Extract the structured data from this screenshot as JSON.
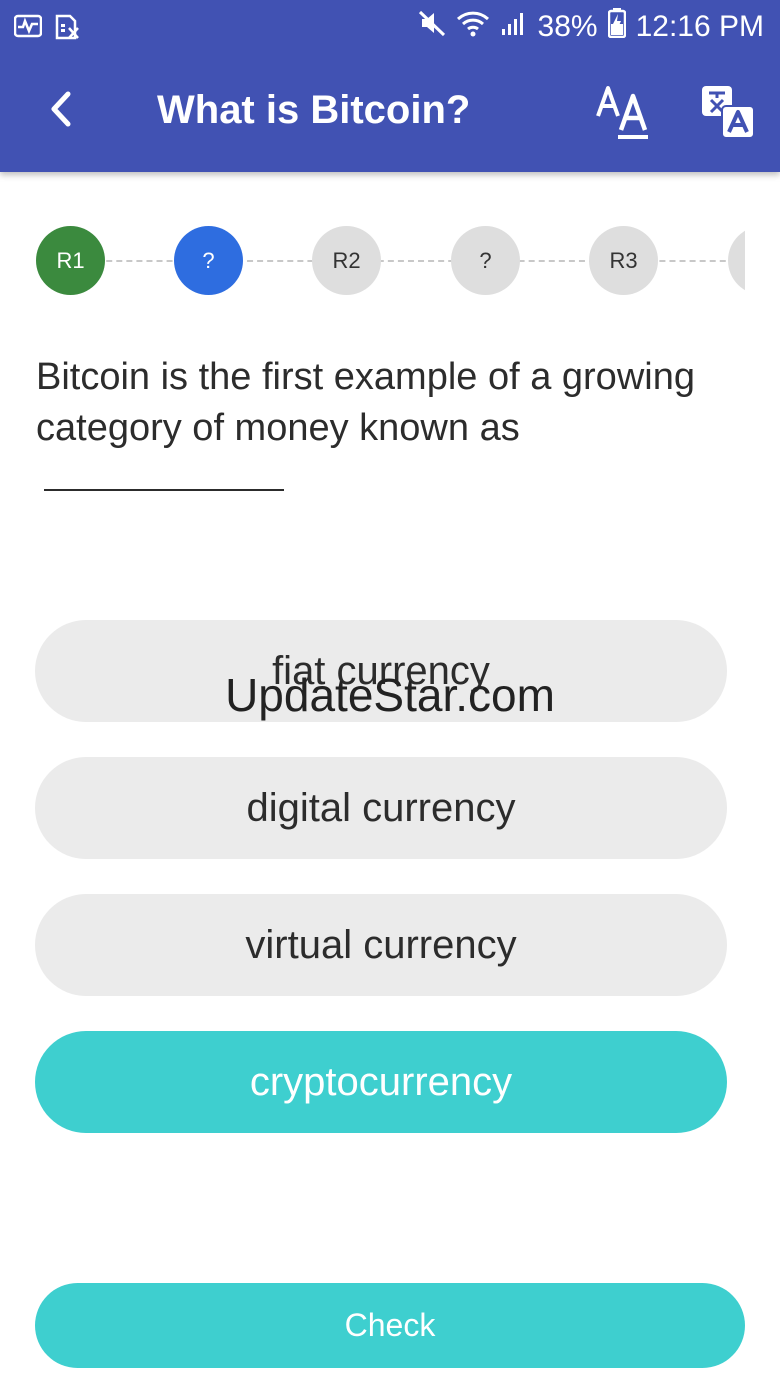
{
  "status_bar": {
    "battery": "38%",
    "time": "12:16 PM",
    "icons": [
      "activity-icon",
      "sim-off-icon",
      "mute-icon",
      "wifi-icon",
      "signal-icon",
      "battery-charging-icon"
    ]
  },
  "header": {
    "title": "What is Bitcoin?",
    "back_icon": "back-chevron-icon",
    "font_size_icon": "font-size-icon",
    "translate_icon": "translate-icon",
    "color": "#4152b3"
  },
  "progress": {
    "steps": [
      {
        "label": "R1",
        "state": "done"
      },
      {
        "label": "?",
        "state": "current"
      },
      {
        "label": "R2",
        "state": "pending"
      },
      {
        "label": "?",
        "state": "pending"
      },
      {
        "label": "R3",
        "state": "pending"
      },
      {
        "label": "",
        "state": "pending"
      }
    ]
  },
  "question": {
    "text": "Bitcoin is the first example of a growing category of money known as"
  },
  "options": [
    {
      "label": "fiat currency",
      "selected": false
    },
    {
      "label": "digital currency",
      "selected": false
    },
    {
      "label": "virtual currency",
      "selected": false
    },
    {
      "label": "cryptocurrency",
      "selected": true
    }
  ],
  "watermark": "UpdateStar.com",
  "check_button": {
    "label": "Check"
  },
  "colors": {
    "accent": "#3ecfcf",
    "done": "#3b8a3e",
    "current": "#2e6de0"
  }
}
